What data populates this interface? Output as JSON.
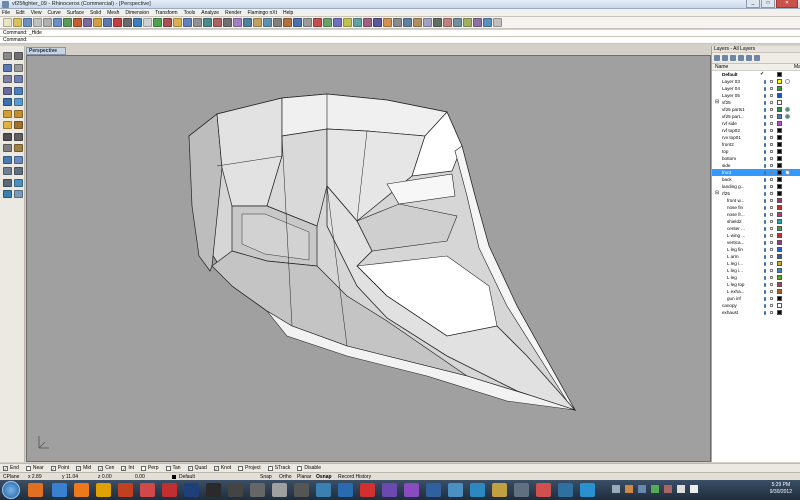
{
  "window": {
    "title": "vf25fighter_09 - Rhinoceros (Commercial) - [Perspective]",
    "controls": {
      "minimize": "_",
      "maximize": "□",
      "close": "✕"
    }
  },
  "menu": [
    "File",
    "Edit",
    "View",
    "Curve",
    "Surface",
    "Solid",
    "Mesh",
    "Dimension",
    "Transform",
    "Tools",
    "Analyze",
    "Render",
    "Flamingo nXt",
    "Help"
  ],
  "command_history": "Command: _Hide",
  "command_prompt": "Command:",
  "viewport": {
    "label": "Perspective"
  },
  "layers_panel": {
    "title": "Layers - All Layers",
    "column_name": "Name",
    "column_mat": "Ma",
    "current_mark": "✓",
    "rows": [
      {
        "name": "Default",
        "color": "#000000",
        "bold": true,
        "current": true
      },
      {
        "name": "Layer 03",
        "color": "#ffff00"
      },
      {
        "name": "Layer 04",
        "color": "#22aa22"
      },
      {
        "name": "Layer 05",
        "color": "#1f4fd1"
      },
      {
        "name": "vf25",
        "color": "#ffffff",
        "expander": "⊟"
      },
      {
        "name": "vf25 parts1",
        "color": "#2e8b57"
      },
      {
        "name": "vf25 part...",
        "color": "#4682b4"
      },
      {
        "name": "rvf side",
        "color": "#b04ec8"
      },
      {
        "name": "rvf top02",
        "color": "#000000"
      },
      {
        "name": "rvv top01",
        "color": "#000000"
      },
      {
        "name": "front2",
        "color": "#000000"
      },
      {
        "name": "top",
        "color": "#000000"
      },
      {
        "name": "bottom",
        "color": "#000000"
      },
      {
        "name": "side",
        "color": "#000000"
      },
      {
        "name": "front",
        "color": "#000000",
        "selected": true
      },
      {
        "name": "back",
        "color": "#000000"
      },
      {
        "name": "landing g...",
        "color": "#000000"
      },
      {
        "name": "rf25",
        "color": "#000000",
        "expander": "⊟"
      },
      {
        "name": "front w...",
        "color": "#a03080",
        "indent": true
      },
      {
        "name": "nose fin",
        "color": "#c03030",
        "indent": true
      },
      {
        "name": "nose fr...",
        "color": "#c03080",
        "indent": true
      },
      {
        "name": "shield2",
        "color": "#30a0a0",
        "indent": true
      },
      {
        "name": "center ...",
        "color": "#30a050",
        "indent": true
      },
      {
        "name": "L wing ...",
        "color": "#c03030",
        "indent": true
      },
      {
        "name": "vertica...",
        "color": "#a030a0",
        "indent": true
      },
      {
        "name": "L leg fin",
        "color": "#3060c0",
        "indent": true
      },
      {
        "name": "L arm",
        "color": "#306090",
        "indent": true
      },
      {
        "name": "L leg i...",
        "color": "#c0b030",
        "indent": true
      },
      {
        "name": "L leg i...",
        "color": "#2090c0",
        "indent": true
      },
      {
        "name": "L leg",
        "color": "#60a030",
        "indent": true
      },
      {
        "name": "L leg top",
        "color": "#c03060",
        "indent": true
      },
      {
        "name": "L exha...",
        "color": "#a06030",
        "indent": true
      },
      {
        "name": "gun inf",
        "color": "#000000",
        "indent": true
      },
      {
        "name": "canopy",
        "color": "#ffffff"
      },
      {
        "name": "exhaust",
        "color": "#000000"
      }
    ]
  },
  "osnap": [
    {
      "label": "End",
      "checked": true
    },
    {
      "label": "Near",
      "checked": false
    },
    {
      "label": "Point",
      "checked": true
    },
    {
      "label": "Mid",
      "checked": true
    },
    {
      "label": "Cen",
      "checked": true
    },
    {
      "label": "Int",
      "checked": true
    },
    {
      "label": "Perp",
      "checked": false
    },
    {
      "label": "Tan",
      "checked": false
    },
    {
      "label": "Quad",
      "checked": true
    },
    {
      "label": "Knot",
      "checked": true
    },
    {
      "label": "Project",
      "checked": false
    },
    {
      "label": "STrack",
      "checked": false
    },
    {
      "label": "Disable",
      "checked": false
    }
  ],
  "status": {
    "cplane": "CPlane",
    "x": "x 2.89",
    "y": "y 11.04",
    "z": "z 0.00",
    "extra": "0.00",
    "layer": "Default",
    "snap": "Snap",
    "ortho": "Ortho",
    "planar": "Planar",
    "osnap": "Osnap",
    "record_history": "Record History"
  },
  "taskbar": {
    "time": "5:29 PM",
    "date": "9/30/2012"
  },
  "colors": {
    "viewport_bg": "#a0a0a0",
    "selection": "#3399ff"
  }
}
